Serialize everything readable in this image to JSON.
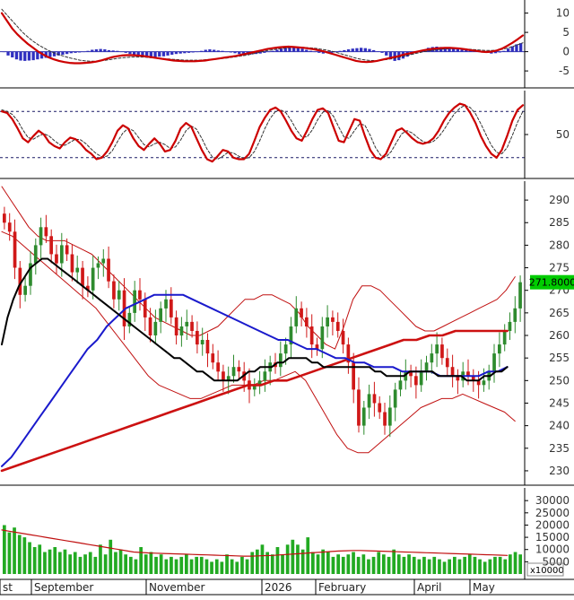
{
  "chart_data": [
    {
      "panel": "macd",
      "type": "line",
      "y_ticks": [
        "10",
        "5",
        "0",
        "-5"
      ],
      "ylim": [
        -8,
        12
      ],
      "histogram": [
        0,
        -1,
        -1.5,
        -2,
        -2.3,
        -2.4,
        -2.3,
        -2.2,
        -2,
        -1.8,
        -1.6,
        -1.4,
        -1.2,
        -1,
        -0.8,
        -0.6,
        -0.4,
        -0.3,
        -0.2,
        -0.1,
        0.2,
        0.5,
        0.6,
        0.7,
        0.6,
        0.4,
        0.3,
        0.2,
        0,
        -0.3,
        -0.6,
        -0.9,
        -1.2,
        -1.4,
        -1.5,
        -1.5,
        -1.4,
        -1.3,
        -1.2,
        -1,
        -0.8,
        -0.6,
        -0.5,
        -0.4,
        -0.3,
        -0.2,
        -0.1,
        0.2,
        0.5,
        0.6,
        0.5,
        0.3,
        0.2,
        0,
        -0.2,
        -0.4,
        -0.6,
        -0.7,
        -0.8,
        -0.7,
        -0.6,
        -0.5,
        -0.3,
        -0.1,
        0.2,
        0.5,
        0.8,
        1.1,
        1.3,
        1.3,
        1.1,
        0.8,
        0.5,
        0.2,
        -0.1,
        -0.3,
        -0.5,
        -0.4,
        -0.3,
        -0.1,
        0.2,
        0.4,
        0.6,
        0.8,
        0.9,
        1,
        0.9,
        0.7,
        0.4,
        0.1,
        -0.3,
        -1,
        -2,
        -2.4,
        -2.2,
        -1.8,
        -1.3,
        -0.8,
        -0.4,
        0,
        0.5,
        1,
        1.2,
        1.3,
        1.2,
        1.1,
        1,
        0.8,
        0.6,
        0.5,
        0.4,
        0.3,
        0.2,
        0.1,
        0,
        -0.2,
        -0.5,
        -0.4,
        -0.2,
        0.2,
        0.8,
        1.4,
        1.9,
        2.2
      ],
      "macd": [
        10,
        8,
        6,
        4.5,
        3.2,
        2,
        1,
        0,
        -0.8,
        -1.5,
        -2,
        -2.4,
        -2.7,
        -2.9,
        -3,
        -3,
        -2.9,
        -2.8,
        -2.6,
        -2.3,
        -1.9,
        -1.5,
        -1.2,
        -1,
        -0.9,
        -0.9,
        -1,
        -1.1,
        -1.3,
        -1.5,
        -1.7,
        -1.9,
        -2.1,
        -2.3,
        -2.4,
        -2.5,
        -2.5,
        -2.5,
        -2.4,
        -2.3,
        -2.1,
        -1.9,
        -1.7,
        -1.5,
        -1.3,
        -1.1,
        -0.8,
        -0.5,
        -0.2,
        0.1,
        0.4,
        0.7,
        0.9,
        1.1,
        1.2,
        1.3,
        1.2,
        1.1,
        1,
        0.8,
        0.6,
        0.3,
        0,
        -0.4,
        -0.8,
        -1.2,
        -1.6,
        -2,
        -2.4,
        -2.6,
        -2.7,
        -2.6,
        -2.4,
        -2.1,
        -1.8,
        -1.5,
        -1.2,
        -0.8,
        -0.5,
        -0.2,
        0.1,
        0.4,
        0.6,
        0.8,
        0.9,
        1,
        1,
        0.9,
        0.8,
        0.6,
        0.4,
        0.2,
        0,
        -0.1,
        0,
        0.3,
        0.8,
        1.5,
        2.3,
        3.2,
        4.2
      ],
      "signal": [
        11,
        9.5,
        8,
        6.5,
        5,
        3.8,
        2.7,
        1.8,
        1,
        0.3,
        -0.3,
        -0.8,
        -1.2,
        -1.6,
        -1.9,
        -2.2,
        -2.4,
        -2.5,
        -2.5,
        -2.4,
        -2.2,
        -2,
        -1.8,
        -1.6,
        -1.5,
        -1.4,
        -1.4,
        -1.4,
        -1.5,
        -1.6,
        -1.7,
        -1.8,
        -1.9,
        -2,
        -2.1,
        -2.2,
        -2.2,
        -2.2,
        -2.2,
        -2.1,
        -2,
        -1.9,
        -1.8,
        -1.7,
        -1.5,
        -1.3,
        -1.1,
        -0.9,
        -0.6,
        -0.3,
        0,
        0.3,
        0.5,
        0.7,
        0.9,
        1,
        1.1,
        1.1,
        1.1,
        1,
        0.9,
        0.7,
        0.5,
        0.2,
        -0.1,
        -0.5,
        -0.9,
        -1.3,
        -1.7,
        -2,
        -2.2,
        -2.3,
        -2.3,
        -2.2,
        -2,
        -1.8,
        -1.5,
        -1.2,
        -0.9,
        -0.6,
        -0.3,
        0,
        0.2,
        0.4,
        0.6,
        0.7,
        0.8,
        0.8,
        0.8,
        0.7,
        0.6,
        0.5,
        0.4,
        0.3,
        0.3,
        0.4,
        0.6,
        0.9,
        1.3,
        1.8,
        2.3
      ]
    },
    {
      "panel": "stochastic",
      "type": "line",
      "y_ticks": [
        "50"
      ],
      "ylim": [
        0,
        100
      ],
      "reference_lines": [
        80,
        20
      ],
      "k": [
        80,
        78,
        70,
        58,
        45,
        40,
        48,
        55,
        50,
        40,
        35,
        32,
        40,
        46,
        44,
        38,
        30,
        25,
        18,
        20,
        28,
        40,
        55,
        62,
        58,
        45,
        35,
        30,
        38,
        45,
        38,
        28,
        30,
        42,
        58,
        65,
        60,
        45,
        30,
        18,
        15,
        22,
        30,
        28,
        20,
        18,
        18,
        25,
        42,
        60,
        72,
        82,
        85,
        80,
        68,
        55,
        45,
        42,
        55,
        70,
        82,
        84,
        78,
        60,
        42,
        40,
        55,
        70,
        68,
        48,
        30,
        20,
        18,
        25,
        40,
        55,
        58,
        52,
        45,
        40,
        38,
        40,
        45,
        55,
        68,
        78,
        85,
        90,
        88,
        78,
        65,
        48,
        35,
        25,
        20,
        30,
        48,
        68,
        82,
        88
      ],
      "d": [
        82,
        80,
        76,
        68,
        56,
        46,
        44,
        48,
        51,
        48,
        42,
        37,
        36,
        40,
        44,
        43,
        38,
        31,
        25,
        21,
        22,
        29,
        41,
        52,
        58,
        55,
        46,
        37,
        34,
        38,
        40,
        37,
        32,
        34,
        43,
        55,
        61,
        57,
        45,
        31,
        21,
        18,
        22,
        27,
        26,
        22,
        19,
        20,
        28,
        42,
        58,
        71,
        80,
        82,
        78,
        68,
        56,
        47,
        47,
        56,
        69,
        79,
        81,
        74,
        60,
        47,
        45,
        55,
        64,
        62,
        49,
        33,
        23,
        21,
        28,
        40,
        51,
        55,
        52,
        46,
        41,
        39,
        41,
        47,
        56,
        67,
        77,
        84,
        88,
        85,
        77,
        64,
        50,
        36,
        27,
        25,
        33,
        49,
        66,
        80
      ]
    },
    {
      "panel": "price",
      "type": "candlestick",
      "y_ticks": [
        "290",
        "285",
        "280",
        "275",
        "270",
        "265",
        "260",
        "255",
        "250",
        "245",
        "240",
        "235",
        "230"
      ],
      "ylim": [
        228,
        293
      ],
      "last_price_label": "271.8000",
      "last_price": 271.8,
      "x_labels": [
        "st",
        "September",
        "November",
        "2026",
        "February",
        "April",
        "May"
      ],
      "close": [
        285,
        283,
        275,
        269,
        271,
        276,
        280,
        284,
        282,
        278,
        276,
        280,
        278,
        274,
        275,
        271,
        270,
        275,
        276,
        277,
        272,
        268,
        270,
        262,
        265,
        270,
        268,
        264,
        260,
        263,
        266,
        268,
        264,
        260,
        262,
        263,
        261,
        258,
        259,
        256,
        254,
        252,
        250,
        251,
        253,
        252,
        250,
        248,
        249,
        250,
        252,
        254,
        253,
        256,
        258,
        262,
        266,
        264,
        262,
        258,
        257,
        262,
        264,
        263,
        261,
        258,
        254,
        248,
        240,
        244,
        247,
        245,
        243,
        240,
        244,
        248,
        250,
        252,
        251,
        249,
        252,
        254,
        256,
        258,
        255,
        253,
        251,
        250,
        252,
        251,
        250,
        249,
        250,
        252,
        256,
        258,
        261,
        263,
        266,
        271.8
      ],
      "open": [
        287,
        285,
        283,
        275,
        269,
        271,
        276,
        280,
        284,
        282,
        278,
        276,
        280,
        278,
        274,
        275,
        271,
        270,
        275,
        276,
        277,
        272,
        268,
        270,
        262,
        265,
        270,
        268,
        264,
        260,
        263,
        266,
        268,
        264,
        260,
        262,
        263,
        261,
        258,
        259,
        256,
        254,
        252,
        250,
        251,
        253,
        252,
        250,
        248,
        249,
        250,
        252,
        254,
        253,
        256,
        258,
        262,
        266,
        264,
        262,
        258,
        257,
        262,
        264,
        263,
        261,
        258,
        254,
        248,
        240,
        244,
        247,
        245,
        243,
        240,
        244,
        248,
        250,
        252,
        251,
        249,
        252,
        254,
        256,
        258,
        255,
        253,
        251,
        250,
        252,
        251,
        250,
        249,
        250,
        252,
        256,
        258,
        261,
        263,
        266
      ],
      "sma20": [
        258,
        264,
        268,
        271,
        273,
        275,
        276,
        277,
        277,
        276,
        275,
        274,
        273,
        272,
        271,
        270,
        269,
        268,
        267,
        266,
        265,
        264,
        263,
        262,
        261,
        260,
        259,
        258,
        257,
        256,
        255,
        255,
        254,
        253,
        252,
        252,
        251,
        250,
        250,
        250,
        250,
        250,
        251,
        252,
        252,
        253,
        253,
        253,
        254,
        254,
        255,
        255,
        255,
        255,
        254,
        254,
        253,
        253,
        253,
        253,
        253,
        253,
        253,
        253,
        253,
        252,
        252,
        251,
        251,
        251,
        251,
        252,
        252,
        252,
        252,
        252,
        251,
        251,
        251,
        251,
        251,
        250,
        250,
        250,
        251,
        251,
        252,
        252,
        253
      ],
      "sma50": [
        231,
        233,
        236,
        239,
        242,
        245,
        248,
        251,
        254,
        257,
        259,
        262,
        264,
        266,
        267,
        268,
        269,
        269,
        269,
        269,
        268,
        267,
        266,
        265,
        264,
        263,
        262,
        261,
        260,
        259,
        259,
        258,
        257,
        257,
        256,
        255,
        255,
        254,
        254,
        253,
        253,
        253,
        252,
        252,
        252,
        252,
        251,
        251,
        251,
        251,
        251,
        252,
        252,
        253
      ],
      "sma200": [
        230,
        231,
        232,
        233,
        234,
        235,
        236,
        237,
        238,
        239,
        240,
        241,
        242,
        243,
        244,
        245,
        246,
        247,
        248,
        249,
        249,
        250,
        250,
        251,
        252,
        253,
        254,
        255,
        256,
        257,
        258,
        259,
        259,
        260,
        260,
        261,
        261,
        261,
        261,
        261
      ],
      "bb_upper": [
        293,
        290,
        287,
        284,
        282,
        281,
        281,
        281,
        280,
        279,
        278,
        276,
        274,
        272,
        270,
        268,
        266,
        264,
        263,
        262,
        261,
        260,
        260,
        261,
        262,
        264,
        266,
        268,
        268,
        269,
        269,
        268,
        267,
        265,
        262,
        260,
        258,
        257,
        262,
        268,
        271,
        271,
        270,
        268,
        266,
        264,
        262,
        261,
        261,
        262,
        263,
        264,
        265,
        266,
        267,
        268,
        270,
        273
      ],
      "bb_lower": [
        283,
        282,
        280,
        278,
        276,
        274,
        272,
        270,
        268,
        266,
        263,
        260,
        257,
        254,
        251,
        249,
        248,
        247,
        246,
        246,
        247,
        248,
        249,
        249,
        249,
        250,
        250,
        251,
        252,
        250,
        246,
        242,
        238,
        235,
        234,
        234,
        236,
        238,
        240,
        242,
        244,
        245,
        246,
        246,
        247,
        246,
        245,
        244,
        243,
        241
      ]
    },
    {
      "panel": "volume",
      "type": "bar",
      "y_ticks": [
        "30000",
        "25000",
        "20000",
        "15000",
        "10000",
        "5000"
      ],
      "unit_label": "x10000",
      "ylim": [
        0,
        33000
      ],
      "values": [
        20000,
        17000,
        19000,
        16000,
        15000,
        13000,
        11000,
        12000,
        9000,
        10000,
        11000,
        9000,
        10000,
        8000,
        9000,
        7000,
        8000,
        9000,
        7000,
        12000,
        8000,
        14000,
        9000,
        10000,
        8000,
        7000,
        6000,
        11000,
        8000,
        9000,
        7000,
        8000,
        6000,
        7000,
        6000,
        7000,
        8000,
        6000,
        7000,
        7000,
        6000,
        5000,
        6000,
        5000,
        8000,
        6000,
        5000,
        7000,
        6000,
        9000,
        10000,
        12000,
        9000,
        8000,
        11000,
        8000,
        12000,
        14000,
        12000,
        10000,
        15000,
        9000,
        8000,
        10000,
        9000,
        7000,
        8000,
        7000,
        8000,
        9000,
        7000,
        8000,
        6000,
        7000,
        9000,
        8000,
        7000,
        10000,
        8000,
        7000,
        8000,
        7000,
        6000,
        7000,
        6000,
        7000,
        6000,
        5000,
        6000,
        7000,
        6000,
        7000,
        8000,
        7000,
        6000,
        5000,
        6000,
        7000,
        7000,
        6000,
        8000,
        9000,
        8000
      ],
      "ma": [
        18000,
        17500,
        17000,
        16500,
        16000,
        15500,
        15000,
        14500,
        14000,
        13500,
        13000,
        12500,
        12000,
        11500,
        11000,
        10500,
        10000,
        9500,
        9000,
        8800,
        8600,
        8500,
        8400,
        8300,
        8200,
        8100,
        8000,
        7900,
        7800,
        7700,
        7600,
        7500,
        7400,
        7300,
        7300,
        7400,
        7500,
        7600,
        7800,
        8000,
        8200,
        8400,
        8600,
        8800,
        9000,
        9200,
        9400,
        9500,
        9600,
        9600,
        9500,
        9400,
        9300,
        9200,
        9100,
        9000,
        8900,
        8800,
        8700,
        8600,
        8500,
        8400,
        8300,
        8200,
        8100,
        8000,
        7900,
        7800,
        7700,
        7600
      ]
    }
  ],
  "colors": {
    "up_candle": "#2e8b2e",
    "down_candle": "#d01818",
    "macd_line": "#cc0000",
    "signal_line": "#333333",
    "macd_hist": "#3030c0",
    "stoch_k": "#cc0000",
    "stoch_d": "#333333",
    "sma20": "#000000",
    "sma50": "#1a1acc",
    "sma200": "#cc1111",
    "bollinger": "#c01010",
    "volume_bar": "#22aa22",
    "volume_ma": "#c01010",
    "price_tag": "#00cc00"
  }
}
